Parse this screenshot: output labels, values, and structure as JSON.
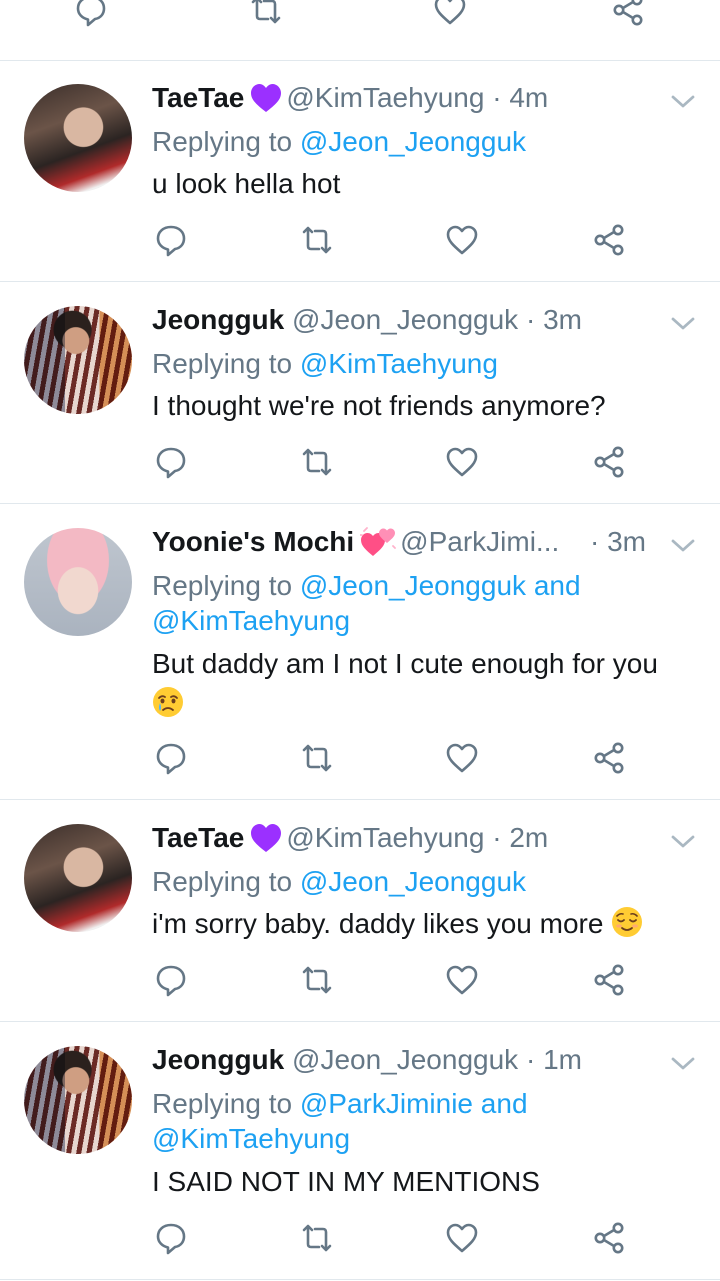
{
  "tweets": [
    {
      "name": "TaeTae",
      "handle": "@KimTaehyung",
      "sep": "·",
      "time": "4m",
      "replying_prefix": "Replying to",
      "replying_to": "@Jeon_Jeongguk",
      "replying_to_2": "",
      "replying_and": "",
      "text": "u look hella hot",
      "badge_icon": "purple-heart-icon"
    },
    {
      "name": "Jeongguk",
      "handle": "@Jeon_Jeongguk",
      "sep": "·",
      "time": "3m",
      "replying_prefix": "Replying to",
      "replying_to": "@KimTaehyung",
      "replying_to_2": "",
      "replying_and": "",
      "text": "I thought we're not friends anymore?",
      "badge_icon": ""
    },
    {
      "name": "Yoonie's Mochi",
      "handle": "@ParkJimi...",
      "sep": "·",
      "time": "3m",
      "replying_prefix": "Replying to",
      "replying_to": "@Jeon_Jeongguk",
      "replying_and": "and",
      "replying_to_2": "@KimTaehyung",
      "text": "But daddy am I not I cute enough for you",
      "text_emoji": "crying-face-emoji",
      "badge_icon": "two-hearts-icon"
    },
    {
      "name": "TaeTae",
      "handle": "@KimTaehyung",
      "sep": "·",
      "time": "2m",
      "replying_prefix": "Replying to",
      "replying_to": "@Jeon_Jeongguk",
      "replying_to_2": "",
      "replying_and": "",
      "text": "i'm sorry baby. daddy likes you more",
      "text_emoji": "relieved-face-emoji",
      "badge_icon": "purple-heart-icon"
    },
    {
      "name": "Jeongguk",
      "handle": "@Jeon_Jeongguk",
      "sep": "·",
      "time": "1m",
      "replying_prefix": "Replying to",
      "replying_to": "@ParkJiminie",
      "replying_and": "and",
      "replying_to_2": "@KimTaehyung",
      "text": "I SAID NOT IN MY MENTIONS",
      "badge_icon": ""
    }
  ],
  "icons": {
    "reply": "reply-icon",
    "retweet": "retweet-icon",
    "like": "heart-icon",
    "share": "share-icon",
    "caret": "chevron-down-icon"
  },
  "colors": {
    "link": "#1da1f2",
    "secondary_text": "#657786",
    "primary_text": "#14171a",
    "divider": "#e1e8ed",
    "purple_heart": "#9b30ff"
  }
}
